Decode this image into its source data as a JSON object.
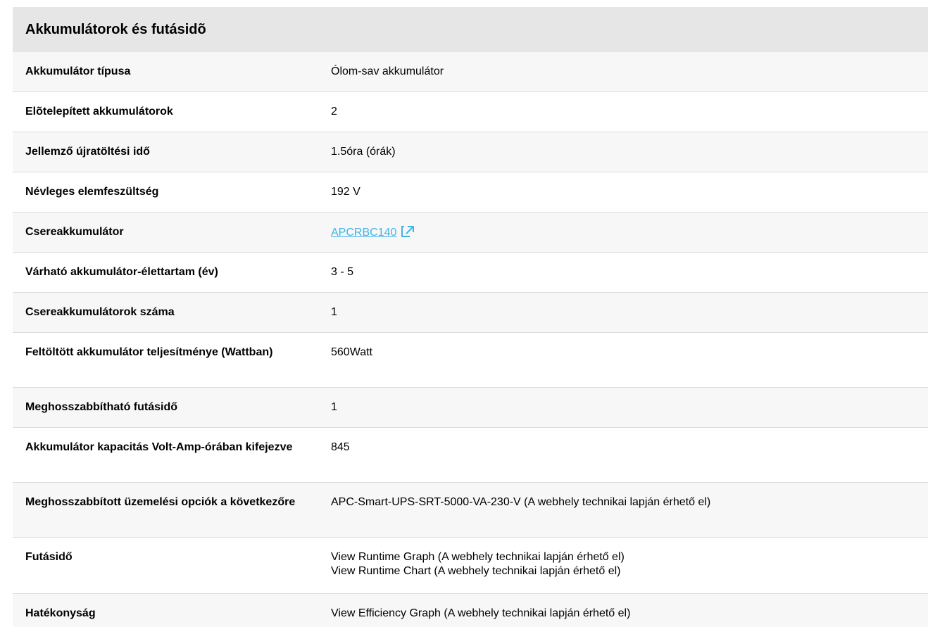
{
  "section": {
    "title": "Akkumulátorok és futásidõ"
  },
  "rows": [
    {
      "label": "Akkumulátor típusa",
      "values": [
        "Ólom-sav akkumulátor"
      ]
    },
    {
      "label": "Elõtelepített akkumulátorok",
      "values": [
        "2"
      ]
    },
    {
      "label": "Jellemző újratöltési idő",
      "values": [
        "1.5óra (órák)"
      ]
    },
    {
      "label": "Névleges elemfeszültség",
      "values": [
        "192 V"
      ]
    },
    {
      "label": "Csereakkumulátor",
      "link": "APCRBC140",
      "link_icon": "external-link-icon"
    },
    {
      "label": "Várható akkumulátor-élettartam (év)",
      "values": [
        "3 - 5"
      ]
    },
    {
      "label": "Csereakkumulátorok száma",
      "values": [
        "1"
      ]
    },
    {
      "label": "Feltöltött akkumulátor teljesítménye (Wattban)",
      "values": [
        "560Watt"
      ]
    },
    {
      "label": "Meghosszabbítható futásidő",
      "values": [
        "1"
      ]
    },
    {
      "label": "Akkumulátor kapacitás Volt-Amp-órában kifejezve",
      "values": [
        "845"
      ]
    },
    {
      "label": "Meghosszabbított üzemelési opciók a következőre",
      "values": [
        "APC-Smart-UPS-SRT-5000-VA-230-V (A webhely technikai lapján érhető el)"
      ]
    },
    {
      "label": "Futásidő",
      "values": [
        "View Runtime Graph (A webhely technikai lapján érhető el)",
        "View Runtime Chart (A webhely technikai lapján érhető el)"
      ]
    },
    {
      "label": "Hatékonyság",
      "values": [
        "View Efficiency Graph (A webhely technikai lapján érhető el)"
      ]
    }
  ],
  "colors": {
    "header_bg": "#e6e6e6",
    "row_alt_bg": "#f7f7f7",
    "link": "#42b4e6"
  }
}
